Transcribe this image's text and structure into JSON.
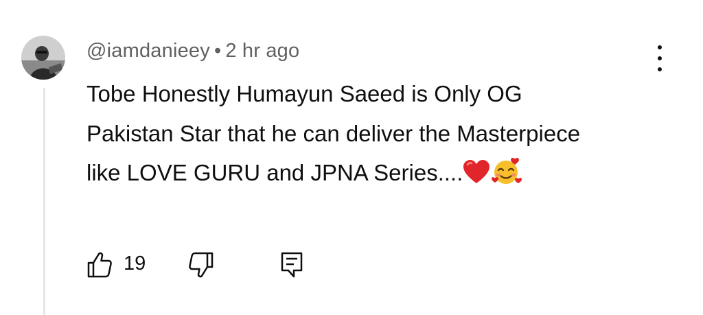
{
  "comment": {
    "author": "@iamdanieey",
    "separator": "•",
    "time": "2 hr ago",
    "text": "Tobe Honestly Humayun Saeed is Only OG Pakistan Star that he can deliver the Masterpiece like LOVE GURU and JPNA Series....",
    "emojis": [
      "red-heart",
      "smiling-face-with-hearts"
    ],
    "likes": "19"
  },
  "icons": {
    "like": "thumbs-up-icon",
    "dislike": "thumbs-down-icon",
    "reply": "reply-comment-icon",
    "menu": "more-vertical-icon"
  },
  "colors": {
    "text": "#0f0f0f",
    "secondary_text": "#606060",
    "thread_line": "#e5e5e5",
    "heart": "#e0262a"
  }
}
